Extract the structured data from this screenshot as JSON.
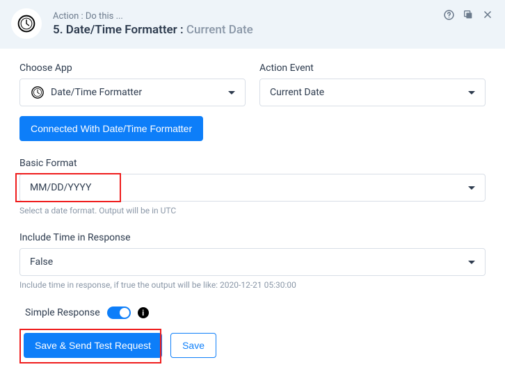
{
  "header": {
    "pre": "Action : Do this ...",
    "title_prefix": "5. Date/Time Formatter :",
    "title_sub": "Current Date"
  },
  "chooseApp": {
    "label": "Choose App",
    "value": "Date/Time Formatter"
  },
  "actionEvent": {
    "label": "Action Event",
    "value": "Current Date"
  },
  "connected_button": "Connected With Date/Time Formatter",
  "basicFormat": {
    "label": "Basic Format",
    "value": "MM/DD/YYYY",
    "hint": "Select a date format. Output will be in UTC"
  },
  "includeTime": {
    "label": "Include Time in Response",
    "value": "False",
    "hint": "Include time in response, if true the output will be like: 2020-12-21 05:30:00"
  },
  "simpleResponse": {
    "label": "Simple Response",
    "enabled": true
  },
  "buttons": {
    "save_send": "Save & Send Test Request",
    "save": "Save"
  }
}
